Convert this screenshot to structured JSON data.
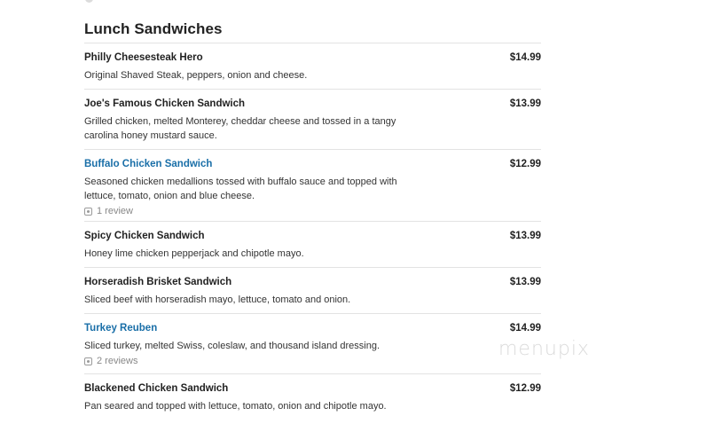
{
  "section": {
    "title": "Lunch Sandwiches"
  },
  "items": [
    {
      "name": "Philly Cheesesteak Hero",
      "price": "$14.99",
      "description": "Original Shaved Steak, peppers, onion and cheese."
    },
    {
      "name": "Joe's Famous Chicken Sandwich",
      "price": "$13.99",
      "description": "Grilled chicken, melted Monterey, cheddar cheese and tossed in a tangy carolina honey mustard sauce."
    },
    {
      "name": "Buffalo Chicken Sandwich",
      "price": "$12.99",
      "description": "Seasoned chicken medallions tossed with buffalo sauce and topped with lettuce, tomato, onion and blue cheese.",
      "reviews": "1 review"
    },
    {
      "name": "Spicy Chicken Sandwich",
      "price": "$13.99",
      "description": "Honey lime chicken pepperjack and chipotle mayo."
    },
    {
      "name": "Horseradish Brisket Sandwich",
      "price": "$13.99",
      "description": "Sliced beef with horseradish mayo, lettuce, tomato and onion."
    },
    {
      "name": "Turkey Reuben",
      "price": "$14.99",
      "description": "Sliced turkey, melted Swiss, coleslaw, and thousand island dressing.",
      "reviews": "2 reviews"
    },
    {
      "name": "Blackened Chicken Sandwich",
      "price": "$12.99",
      "description": "Pan seared and topped with lettuce, tomato, onion and chipotle mayo."
    }
  ],
  "watermark": "menupix",
  "colors": {
    "link": "#1a6fa8",
    "text": "#222222",
    "divider": "#e3e3e3",
    "muted": "#888888"
  }
}
